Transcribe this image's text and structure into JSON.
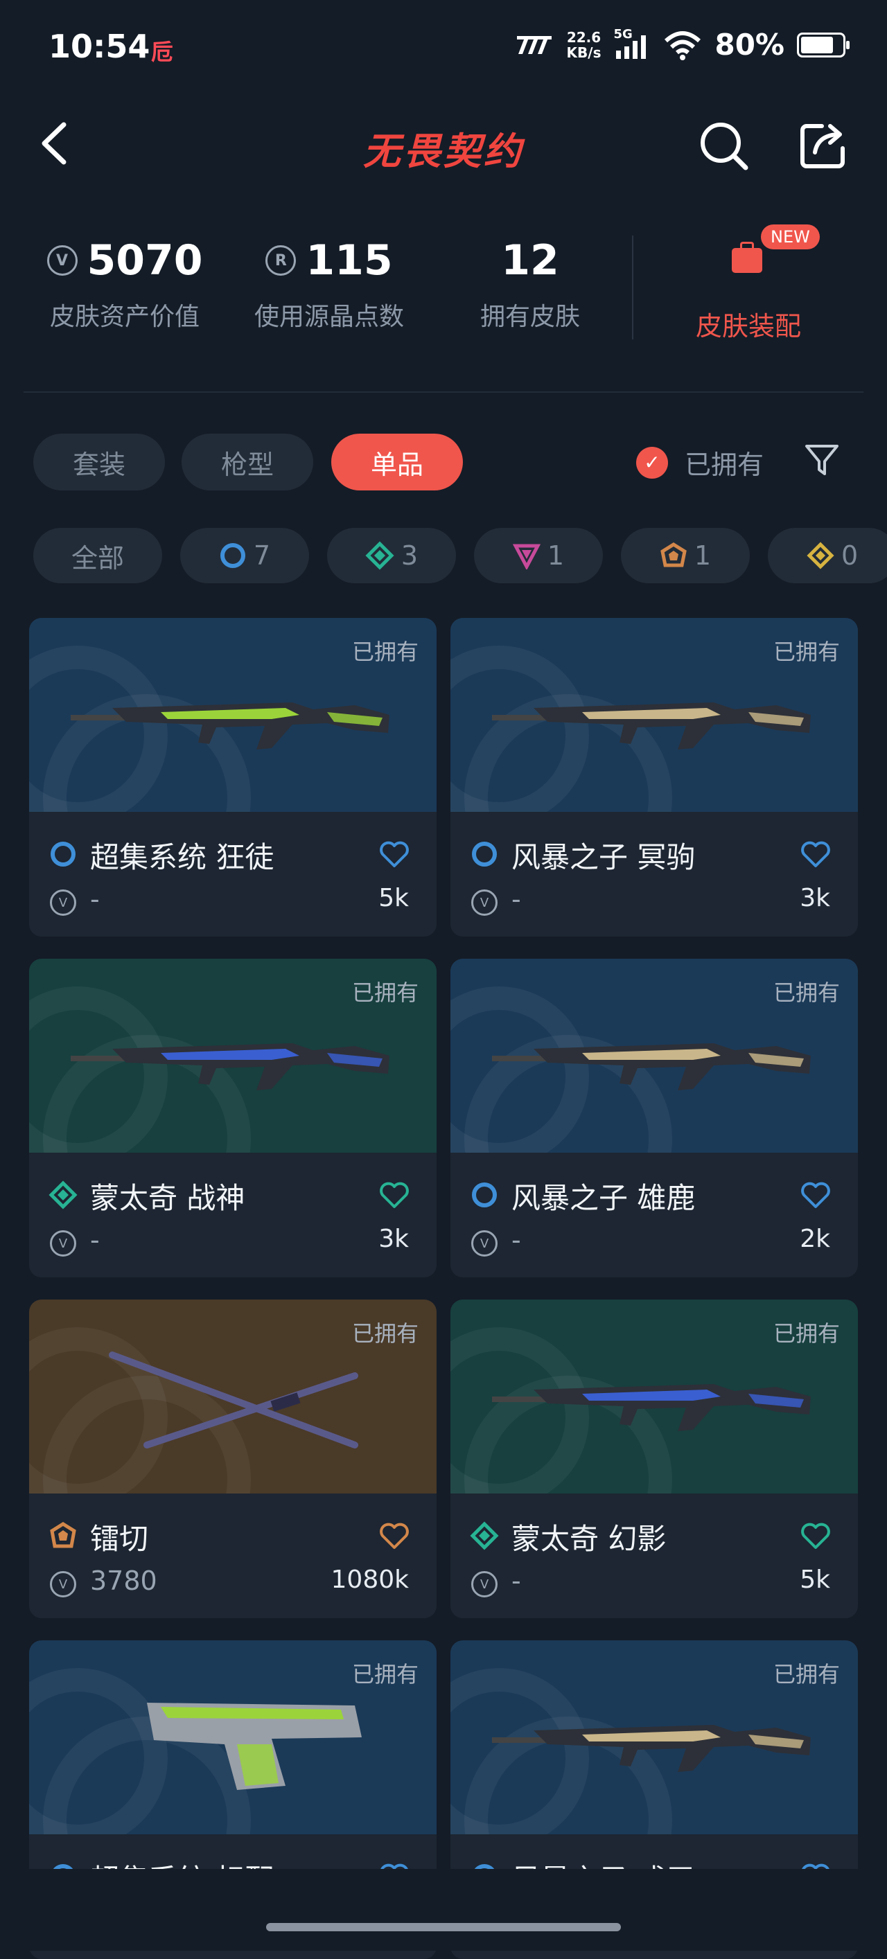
{
  "status_bar": {
    "time": "10:54",
    "app_badge": "卮",
    "net_speed_value": "22.6",
    "net_speed_unit": "KB/s",
    "network": "5G",
    "battery_pct": "80%",
    "battery_level": 0.8
  },
  "header": {
    "title": "无畏契约"
  },
  "stats": {
    "asset_value": "5070",
    "asset_value_label": "皮肤资产价值",
    "radianite_points": "115",
    "radianite_points_label": "使用源晶点数",
    "skins_owned": "12",
    "skins_owned_label": "拥有皮肤",
    "loadout_label": "皮肤装配",
    "loadout_badge": "NEW"
  },
  "tabs": [
    "套装",
    "枪型",
    "单品"
  ],
  "active_tab": "单品",
  "owned_filter": {
    "label": "已拥有",
    "checked": true
  },
  "rarity_filters": [
    {
      "label": "全部"
    },
    {
      "count": "7",
      "tier": "select",
      "color": "#3f8fd8"
    },
    {
      "count": "3",
      "tier": "deluxe",
      "color": "#27b394"
    },
    {
      "count": "1",
      "tier": "premium",
      "color": "#c84a9a"
    },
    {
      "count": "1",
      "tier": "exclusive",
      "color": "#d3874a"
    },
    {
      "count": "0",
      "tier": "ultra",
      "color": "#d7b340"
    }
  ],
  "cards": [
    {
      "owned": "已拥有",
      "name": "超集系统 狂徒",
      "price": "-",
      "likes": "5k",
      "tier_color": "#3f8fd8",
      "bg": "blue",
      "weapon_color": "#9bd43a"
    },
    {
      "owned": "已拥有",
      "name": "风暴之子 冥驹",
      "price": "-",
      "likes": "3k",
      "tier_color": "#3f8fd8",
      "bg": "blue",
      "weapon_color": "#c9b68a"
    },
    {
      "owned": "已拥有",
      "name": "蒙太奇 战神",
      "price": "-",
      "likes": "3k",
      "tier_color": "#27b394",
      "bg": "teal",
      "weapon_color": "#3a5fd1"
    },
    {
      "owned": "已拥有",
      "name": "风暴之子 雄鹿",
      "price": "-",
      "likes": "2k",
      "tier_color": "#3f8fd8",
      "bg": "blue",
      "weapon_color": "#c9b68a"
    },
    {
      "owned": "已拥有",
      "name": "镭切",
      "price": "3780",
      "likes": "1080k",
      "tier_color": "#d3874a",
      "bg": "brown",
      "weapon_color": "#5a5a8a"
    },
    {
      "owned": "已拥有",
      "name": "蒙太奇 幻影",
      "price": "-",
      "likes": "5k",
      "tier_color": "#27b394",
      "bg": "teal",
      "weapon_color": "#3a5fd1"
    },
    {
      "owned": "已拥有",
      "name": "超集系统 标配",
      "price": "-",
      "likes": "",
      "tier_color": "#3f8fd8",
      "bg": "blue",
      "weapon_color": "#9bd43a"
    },
    {
      "owned": "已拥有",
      "name": "风暴之子 戍卫",
      "price": "-",
      "likes": "",
      "tier_color": "#3f8fd8",
      "bg": "blue",
      "weapon_color": "#c9b68a"
    }
  ]
}
